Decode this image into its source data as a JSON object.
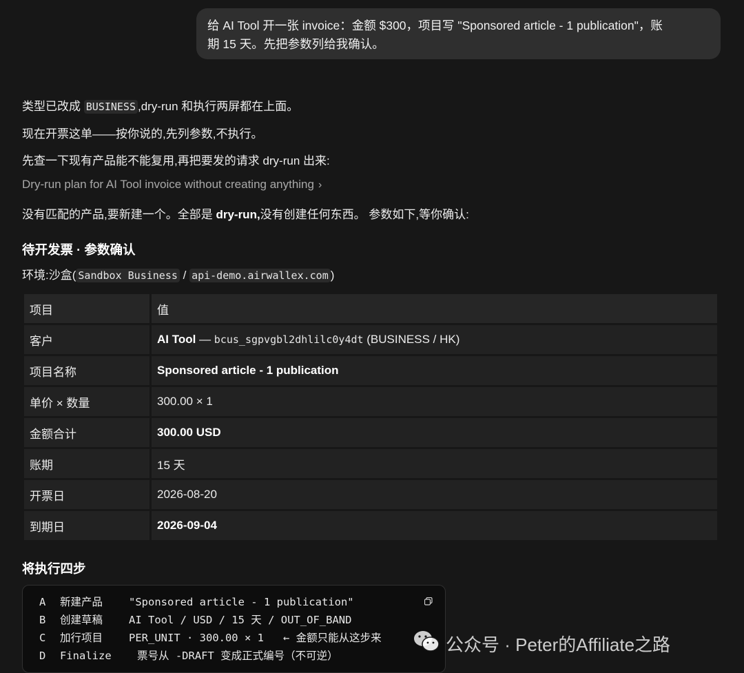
{
  "user_message": {
    "line1": "给 AI Tool 开一张 invoice：金额 $300，项目写 \"Sponsored article - 1 publication\"，账",
    "line2": "期 15 天。先把参数列给我确认。"
  },
  "assistant": {
    "p1_prefix": "类型已改成 ",
    "p1_code": "BUSINESS",
    "p1_suffix": ",dry-run 和执行两屏都在上面。",
    "p2": "现在开票这单——按你说的,先列参数,不执行。",
    "p3": "先查一下现有产品能不能复用,再把要发的请求 dry-run 出来:",
    "tool_call": "Dry-run plan for AI Tool invoice without creating anything",
    "p4_prefix": "没有匹配的产品,要新建一个。全部是 ",
    "p4_bold": "dry-run,",
    "p4_suffix": "没有创建任何东西。 参数如下,等你确认:",
    "section1_title": "待开发票 · 参数确认",
    "env_prefix": "环境:沙盒(",
    "env_code1": "Sandbox Business",
    "env_sep": " / ",
    "env_code2": "api-demo.airwallex.com",
    "env_suffix": ")",
    "table": {
      "headers": [
        "项目",
        "值"
      ],
      "customer_key": "客户",
      "customer_name": "AI Tool",
      "customer_dash": " — ",
      "customer_id": "bcus_sgpvgbl2dhlilc0y4dt",
      "customer_tail": " (BUSINESS / HK)",
      "rows": [
        {
          "k": "项目名称",
          "v": "Sponsored article - 1 publication"
        },
        {
          "k": "单价 × 数量",
          "v": "300.00 × 1"
        },
        {
          "k": "金额合计",
          "v": "300.00 USD"
        },
        {
          "k": "账期",
          "v": "15 天"
        },
        {
          "k": "开票日",
          "v": "2026-08-20"
        },
        {
          "k": "到期日",
          "v": "2026-09-04"
        }
      ]
    },
    "section2_title": "将执行四步",
    "steps": [
      {
        "letter": "A",
        "name": "新建产品",
        "detail": "\"Sponsored article - 1 publication\""
      },
      {
        "letter": "B",
        "name": "创建草稿",
        "detail": "AI Tool / USD / 15 天 / OUT_OF_BAND"
      },
      {
        "letter": "C",
        "name": "加行项目",
        "detail": "PER_UNIT · 300.00 × 1   ← 金额只能从这步来"
      },
      {
        "letter": "D",
        "name": "Finalize",
        "detail": "票号从 -DRAFT 变成正式编号（不可逆）"
      }
    ]
  },
  "watermark": {
    "text": "公众号 · Peter的Affiliate之路",
    "icon": "wechat-icon"
  }
}
